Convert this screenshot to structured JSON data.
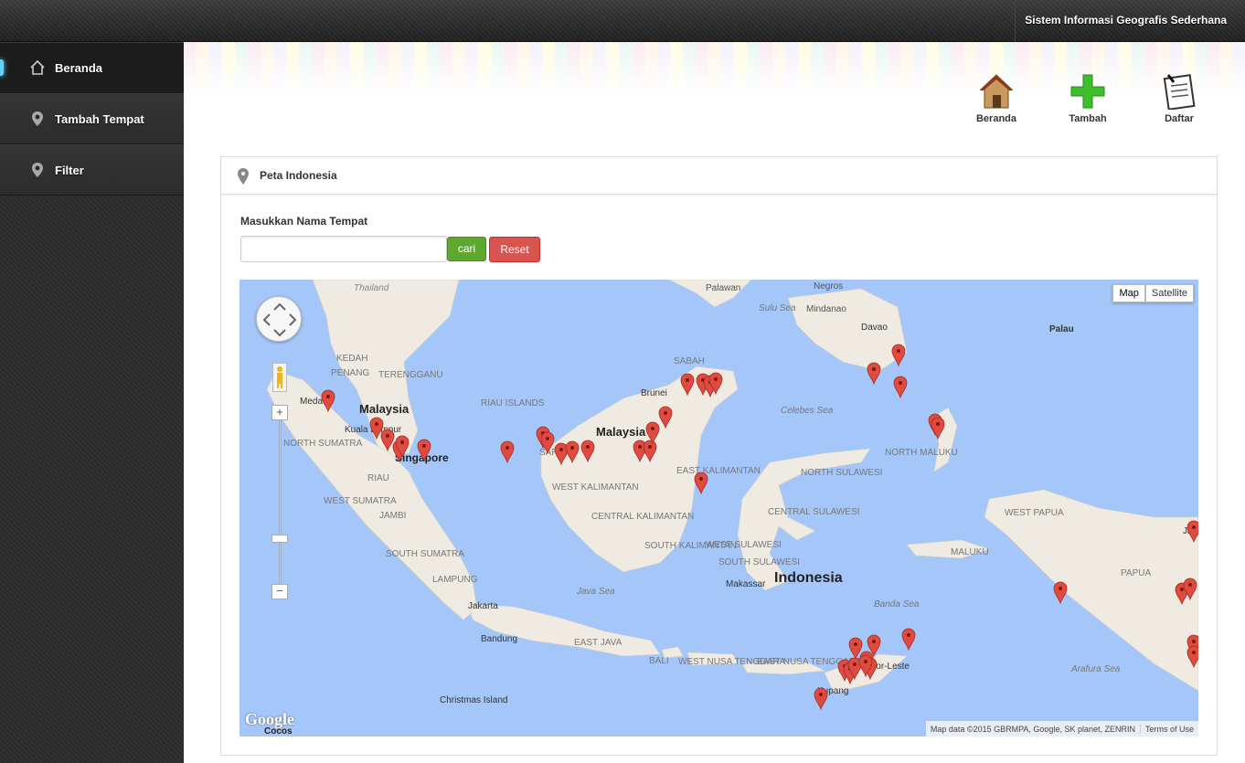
{
  "app": {
    "title": "Sistem Informasi Geografis Sederhana"
  },
  "sidebar": {
    "items": [
      {
        "label": "Beranda",
        "icon": "home-icon",
        "active": true
      },
      {
        "label": "Tambah Tempat",
        "icon": "map-marker-icon",
        "active": false
      },
      {
        "label": "Filter",
        "icon": "map-marker-icon",
        "active": false
      }
    ]
  },
  "toolbar": {
    "home_label": "Beranda",
    "add_label": "Tambah",
    "list_label": "Daftar"
  },
  "panel": {
    "title": "Peta Indonesia"
  },
  "search": {
    "label": "Masukkan Nama Tempat",
    "value": "",
    "placeholder": "",
    "search_button": "cari",
    "reset_button": "Reset"
  },
  "map": {
    "type_buttons": [
      "Map",
      "Satellite"
    ],
    "selected_type": "Map",
    "attribution": "Map data ©2015 GBRMPA, Google, SK planet, ZENRIN",
    "terms": "Terms of Use",
    "logo": "Google",
    "labels": {
      "thailand": "Thailand",
      "palawan": "Palawan",
      "sulu_sea": "Sulu Sea",
      "mindanao": "Mindanao",
      "negros": "Negros",
      "davao": "Davao",
      "palau": "Palau",
      "sabah": "SABAH",
      "kedah": "KEDAH",
      "penang": "PENANG",
      "terengganu": "TERENGGANU",
      "malaysia_w": "Malaysia",
      "medan": "Meda",
      "kuala_lumpur": "Kuala Lumpur",
      "riau_islands": "RIAU ISLANDS",
      "brunei": "Brunei",
      "malaysia_e": "Malaysia",
      "sarawak": "SAR",
      "singapore": "Singapore",
      "north_sumatra": "NORTH SUMATRA",
      "riau": "RIAU",
      "celebes_sea": "Celebes Sea",
      "north_maluku": "NORTH MALUKU",
      "east_kalimantan": "EAST KALIMANTAN",
      "west_kalimantan": "WEST KALIMANTAN",
      "central_kalimantan": "CENTRAL KALIMANTAN",
      "south_kalimantan": "SOUTH KALIMANTAN",
      "west_sumatra": "WEST SUMATRA",
      "jambi": "JAMBI",
      "south_sumatra": "SOUTH SUMATRA",
      "lampung": "LAMPUNG",
      "north_sulawesi": "NORTH SULAWESI",
      "central_sulawesi": "CENTRAL SULAWESI",
      "west_sulawesi": "WEST SULAWESI",
      "south_sulawesi": "SOUTH SULAWESI",
      "makassar": "Makassar",
      "indonesia": "Indonesia",
      "west_papua": "WEST PAPUA",
      "maluku": "MALUKU",
      "papua": "PAPUA",
      "jayapura": "Jaya",
      "java_sea": "Java Sea",
      "jakarta": "Jakarta",
      "bandung": "Bandung",
      "east_java": "EAST JAVA",
      "bali": "BALI",
      "west_nusa_tenggara": "WEST NUSA TENGGARA",
      "east_nusa_tenggara": "EAST NUSA TENGGARA",
      "banda_sea": "Banda Sea",
      "timor_leste": "Timor-Leste",
      "kupang": "Kupang",
      "arafura_sea": "Arafura Sea",
      "christmas_island": "Christmas Island",
      "cocos": "Cocos"
    },
    "marker_color": "#e04b40",
    "water_color": "#a5c6f8",
    "land_color": "#efebe2"
  }
}
